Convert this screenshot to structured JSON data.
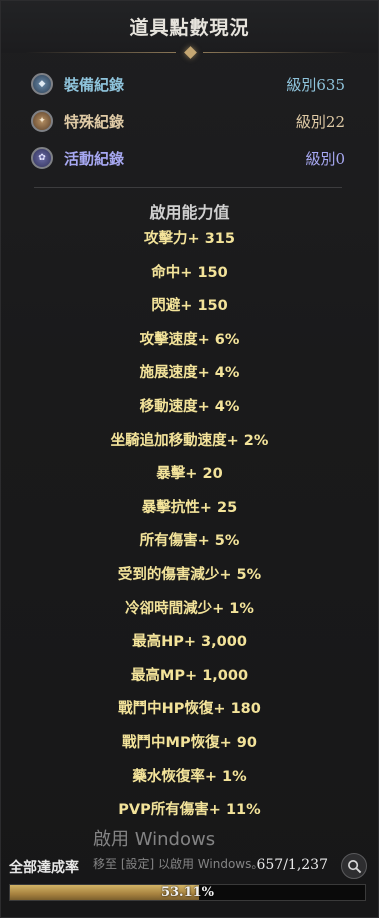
{
  "title": "道具點數現況",
  "records": [
    {
      "icon": "equipment-record-icon",
      "label": "裝備紀錄",
      "level": "級別635",
      "color": "#8fc4dc"
    },
    {
      "icon": "special-record-icon",
      "label": "特殊紀錄",
      "level": "級別22",
      "color": "#e0cba6"
    },
    {
      "icon": "event-record-icon",
      "label": "活動紀錄",
      "level": "級別0",
      "color": "#a7a8f2"
    }
  ],
  "section_title": "啟用能力值",
  "stats": [
    "攻擊力+ 315",
    "命中+ 150",
    "閃避+ 150",
    "攻擊速度+ 6%",
    "施展速度+ 4%",
    "移動速度+ 4%",
    "坐騎追加移動速度+ 2%",
    "暴擊+ 20",
    "暴擊抗性+ 25",
    "所有傷害+ 5%",
    "受到的傷害減少+ 5%",
    "冷卻時間減少+ 1%",
    "最高HP+ 3,000",
    "最高MP+ 1,000",
    "戰鬥中HP恢復+ 180",
    "戰鬥中MP恢復+ 90",
    "藥水恢復率+ 1%",
    "PVP所有傷害+ 11%"
  ],
  "completion": {
    "label": "全部達成率",
    "count": "657/1,237",
    "percent_text": "53.11%",
    "percent": 53.11
  },
  "watermark": {
    "line1": "啟用 Windows",
    "line2": "移至 [設定] 以啟用 Windows。"
  },
  "colors": {
    "stat_text": "#f3e39a",
    "progress_fill": "#c2a257"
  }
}
